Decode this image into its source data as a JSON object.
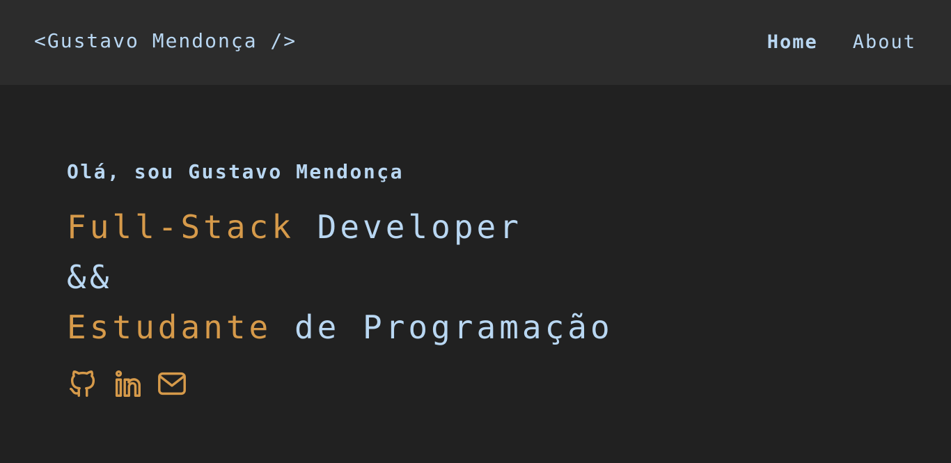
{
  "navbar": {
    "brand": "<Gustavo Mendonça />",
    "links": [
      {
        "label": "Home",
        "active": true
      },
      {
        "label": "About",
        "active": false
      }
    ]
  },
  "hero": {
    "greeting": "Olá, sou Gustavo Mendonça",
    "line1": {
      "accent": "Full-Stack",
      "rest": " Developer"
    },
    "line2": "&&",
    "line3": {
      "accent": "Estudante",
      "rest": " de Programação"
    }
  },
  "socials": [
    {
      "name": "github",
      "icon": "github-icon"
    },
    {
      "name": "linkedin",
      "icon": "linkedin-icon"
    },
    {
      "name": "email",
      "icon": "mail-icon"
    }
  ],
  "colors": {
    "background": "#212121",
    "navbar": "#2c2c2c",
    "text": "#b9d7f2",
    "accent": "#d69a4a"
  }
}
